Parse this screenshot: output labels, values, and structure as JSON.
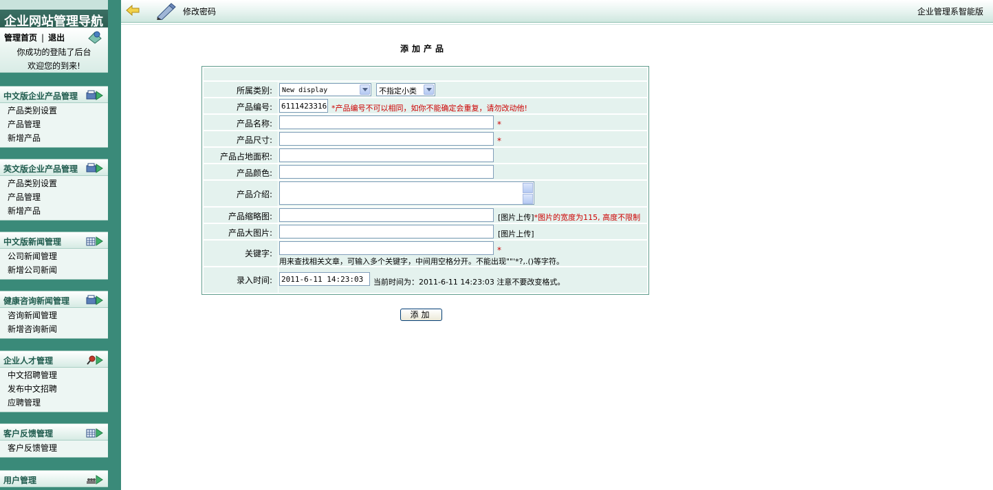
{
  "sidebar": {
    "title": "企业网站管理导航",
    "home": {
      "home_label": "管理首页",
      "separator": "|",
      "logout_label": "退出"
    },
    "welcome_line1": "你成功的登陆了后台",
    "welcome_line2": "欢迎您的到来!",
    "sections": [
      {
        "title": "中文版企业产品管理",
        "items": [
          "产品类别设置",
          "产品管理",
          "新增产品"
        ]
      },
      {
        "title": "英文版企业产品管理",
        "items": [
          "产品类别设置",
          "产品管理",
          "新增产品"
        ]
      },
      {
        "title": "中文版新闻管理",
        "items": [
          "公司新闻管理",
          "新增公司新闻"
        ]
      },
      {
        "title": "健康咨询新闻管理",
        "items": [
          "咨询新闻管理",
          "新增咨询新闻"
        ]
      },
      {
        "title": "企业人才管理",
        "items": [
          "中文招聘管理",
          "发布中文招聘",
          "应聘管理"
        ]
      },
      {
        "title": "客户反馈管理",
        "items": [
          "客户反馈管理"
        ]
      },
      {
        "title": "用户管理",
        "items": []
      }
    ]
  },
  "topbar": {
    "page_name": "修改密码",
    "system_name": "企业管理系智能版"
  },
  "form": {
    "title": "添加产品",
    "category_label": "所属类别:",
    "category_value": "New display",
    "subcategory_value": "不指定小类",
    "code_label": "产品编号:",
    "code_value": "6111423316",
    "code_note": "*产品编号不可以相同，如你不能确定会重复，请勿改动他!",
    "name_label": "产品名称:",
    "size_label": "产品尺寸:",
    "area_label": "产品占地面积:",
    "color_label": "产品颜色:",
    "intro_label": "产品介绍:",
    "thumb_label": "产品缩略图:",
    "thumb_upload": "[图片上传]",
    "thumb_note": "*图片的宽度为115, 高度不限制",
    "bigimg_label": "产品大图片:",
    "bigimg_upload": "[图片上传]",
    "keyword_label": "关键字:",
    "keyword_note": "用来查找相关文章，可输入多个关键字，中间用空格分开。不能出现\"\"'*?,.()等字符。",
    "time_label": "录入时间:",
    "time_value": "2011-6-11 14:23:03",
    "time_note": "当前时间为：2011-6-11 14:23:03 注意不要改变格式。",
    "required_mark": "*",
    "submit_label": "添加"
  },
  "colors": {
    "sidebar_bg": "#3a8a79",
    "row_bg": "#e4f2ee",
    "required": "#cc0000"
  }
}
